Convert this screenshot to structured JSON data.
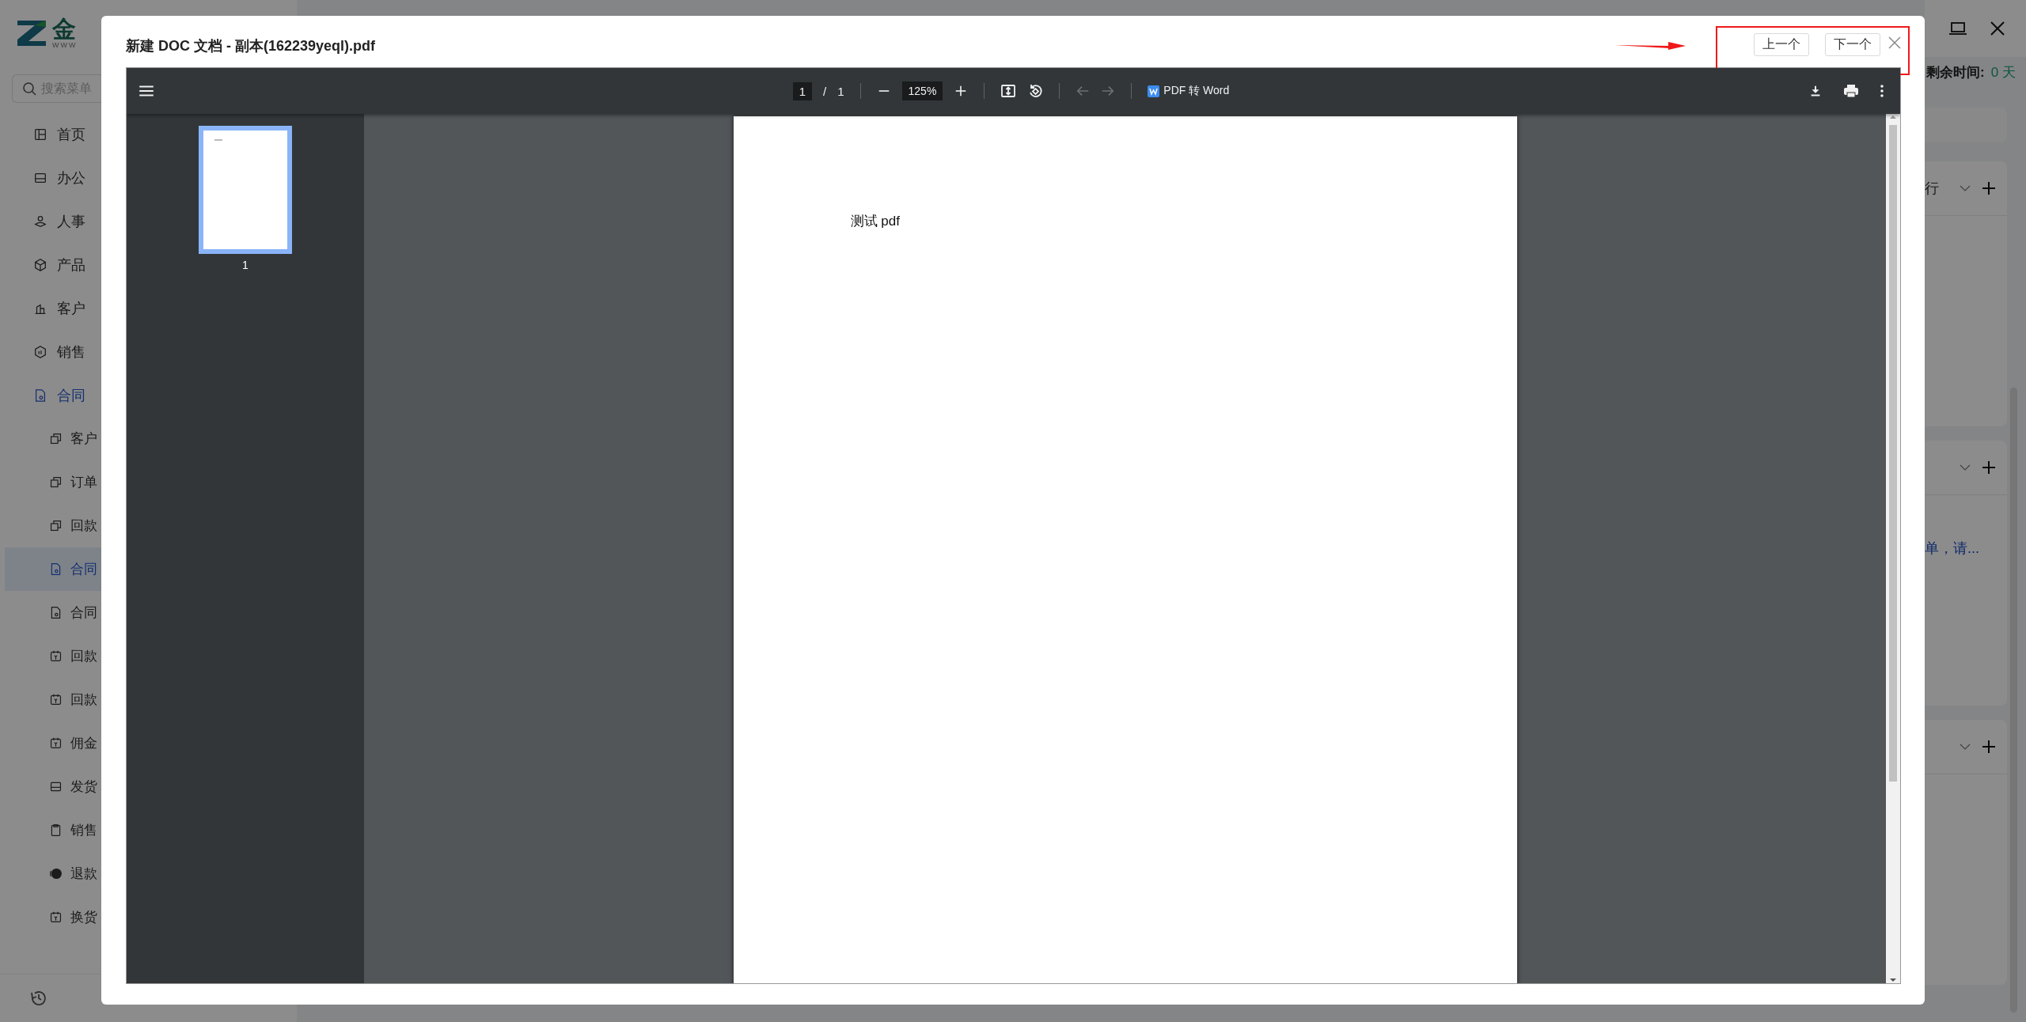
{
  "app": {
    "logo": {
      "text": "金",
      "subtext": "WWW"
    },
    "search": {
      "placeholder": "搜索菜单"
    },
    "menu": [
      {
        "label": "首页",
        "selected": false
      },
      {
        "label": "办公",
        "selected": false
      },
      {
        "label": "人事",
        "selected": false
      },
      {
        "label": "产品",
        "selected": false
      },
      {
        "label": "客户",
        "selected": false
      },
      {
        "label": "销售",
        "selected": false
      },
      {
        "label": "合同",
        "selected": true,
        "children": [
          {
            "label": "客户",
            "selected": false
          },
          {
            "label": "订单",
            "selected": false
          },
          {
            "label": "回款",
            "selected": false
          },
          {
            "label": "合同",
            "selected": true
          },
          {
            "label": "合同",
            "selected": false
          },
          {
            "label": "回款",
            "selected": false
          },
          {
            "label": "回款",
            "selected": false
          },
          {
            "label": "佣金",
            "selected": false
          },
          {
            "label": "发货",
            "selected": false
          },
          {
            "label": "销售",
            "selected": false
          },
          {
            "label": "退款",
            "selected": false
          },
          {
            "label": "换货",
            "selected": false
          }
        ]
      }
    ],
    "header": {
      "remaining_label": "剩余时间:",
      "remaining_value": "0 天"
    },
    "cards": [
      {
        "kind": "titled",
        "title": "行"
      },
      {
        "kind": "link",
        "link": "单，请..."
      },
      {
        "kind": "plain"
      }
    ]
  },
  "modal": {
    "title": "新建 DOC 文档 - 副本(162239yeql).pdf",
    "buttons": [
      "上一个",
      "下一个"
    ],
    "viewer": {
      "page_number": "1",
      "page_separator": "/",
      "page_count": "1",
      "zoom": "125%",
      "prev_disabled": true,
      "next_disabled": true,
      "convert_label": "PDF 转 Word",
      "thumbnails": [
        {
          "label": "1",
          "selected": true
        }
      ],
      "page_text": "测试 pdf"
    }
  }
}
